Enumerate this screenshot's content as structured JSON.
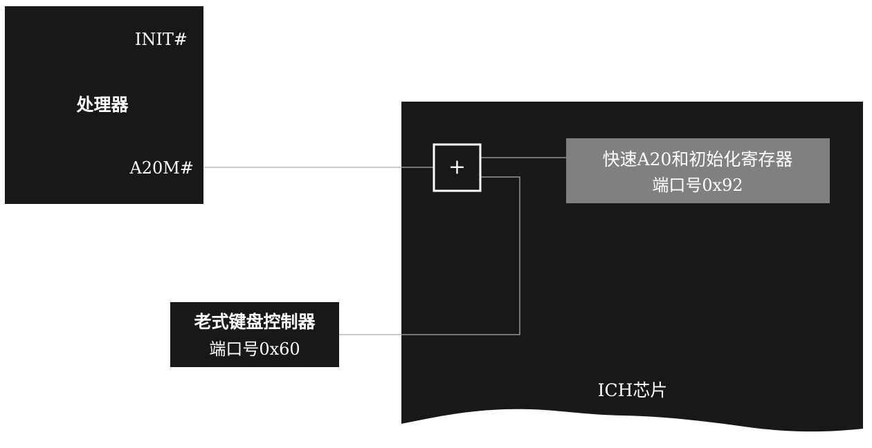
{
  "processor": {
    "title": "处理器",
    "pin_init": "INIT#",
    "pin_a20m": "A20M#"
  },
  "ich": {
    "label": "ICH芯片",
    "or_gate_symbol": "+"
  },
  "fast_a20_register": {
    "line1": "快速A20和初始化寄存器",
    "line2": "端口号0x92"
  },
  "keyboard_controller": {
    "line1": "老式键盘控制器",
    "line2": "端口号0x60"
  },
  "colors": {
    "block_fill": "#181818",
    "register_fill": "#808080",
    "wire": "#aaaaaa",
    "text": "#ffffff",
    "background": "#ffffff"
  }
}
